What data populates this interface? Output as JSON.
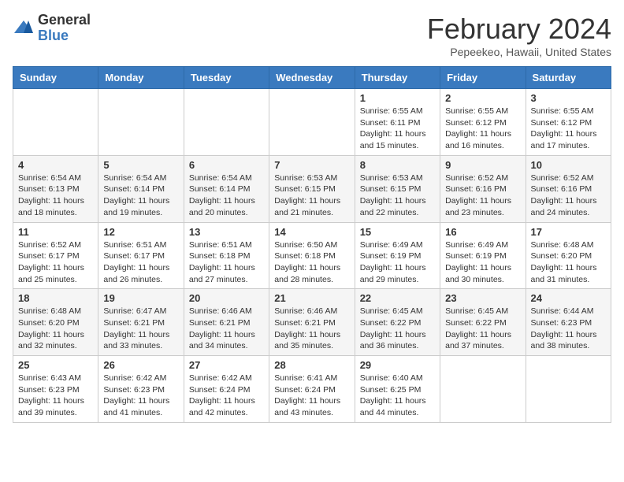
{
  "header": {
    "logo_general": "General",
    "logo_blue": "Blue",
    "month_title": "February 2024",
    "location": "Pepeekeo, Hawaii, United States"
  },
  "days_of_week": [
    "Sunday",
    "Monday",
    "Tuesday",
    "Wednesday",
    "Thursday",
    "Friday",
    "Saturday"
  ],
  "weeks": [
    [
      {
        "day": "",
        "info": ""
      },
      {
        "day": "",
        "info": ""
      },
      {
        "day": "",
        "info": ""
      },
      {
        "day": "",
        "info": ""
      },
      {
        "day": "1",
        "info": "Sunrise: 6:55 AM\nSunset: 6:11 PM\nDaylight: 11 hours and 15 minutes."
      },
      {
        "day": "2",
        "info": "Sunrise: 6:55 AM\nSunset: 6:12 PM\nDaylight: 11 hours and 16 minutes."
      },
      {
        "day": "3",
        "info": "Sunrise: 6:55 AM\nSunset: 6:12 PM\nDaylight: 11 hours and 17 minutes."
      }
    ],
    [
      {
        "day": "4",
        "info": "Sunrise: 6:54 AM\nSunset: 6:13 PM\nDaylight: 11 hours and 18 minutes."
      },
      {
        "day": "5",
        "info": "Sunrise: 6:54 AM\nSunset: 6:14 PM\nDaylight: 11 hours and 19 minutes."
      },
      {
        "day": "6",
        "info": "Sunrise: 6:54 AM\nSunset: 6:14 PM\nDaylight: 11 hours and 20 minutes."
      },
      {
        "day": "7",
        "info": "Sunrise: 6:53 AM\nSunset: 6:15 PM\nDaylight: 11 hours and 21 minutes."
      },
      {
        "day": "8",
        "info": "Sunrise: 6:53 AM\nSunset: 6:15 PM\nDaylight: 11 hours and 22 minutes."
      },
      {
        "day": "9",
        "info": "Sunrise: 6:52 AM\nSunset: 6:16 PM\nDaylight: 11 hours and 23 minutes."
      },
      {
        "day": "10",
        "info": "Sunrise: 6:52 AM\nSunset: 6:16 PM\nDaylight: 11 hours and 24 minutes."
      }
    ],
    [
      {
        "day": "11",
        "info": "Sunrise: 6:52 AM\nSunset: 6:17 PM\nDaylight: 11 hours and 25 minutes."
      },
      {
        "day": "12",
        "info": "Sunrise: 6:51 AM\nSunset: 6:17 PM\nDaylight: 11 hours and 26 minutes."
      },
      {
        "day": "13",
        "info": "Sunrise: 6:51 AM\nSunset: 6:18 PM\nDaylight: 11 hours and 27 minutes."
      },
      {
        "day": "14",
        "info": "Sunrise: 6:50 AM\nSunset: 6:18 PM\nDaylight: 11 hours and 28 minutes."
      },
      {
        "day": "15",
        "info": "Sunrise: 6:49 AM\nSunset: 6:19 PM\nDaylight: 11 hours and 29 minutes."
      },
      {
        "day": "16",
        "info": "Sunrise: 6:49 AM\nSunset: 6:19 PM\nDaylight: 11 hours and 30 minutes."
      },
      {
        "day": "17",
        "info": "Sunrise: 6:48 AM\nSunset: 6:20 PM\nDaylight: 11 hours and 31 minutes."
      }
    ],
    [
      {
        "day": "18",
        "info": "Sunrise: 6:48 AM\nSunset: 6:20 PM\nDaylight: 11 hours and 32 minutes."
      },
      {
        "day": "19",
        "info": "Sunrise: 6:47 AM\nSunset: 6:21 PM\nDaylight: 11 hours and 33 minutes."
      },
      {
        "day": "20",
        "info": "Sunrise: 6:46 AM\nSunset: 6:21 PM\nDaylight: 11 hours and 34 minutes."
      },
      {
        "day": "21",
        "info": "Sunrise: 6:46 AM\nSunset: 6:21 PM\nDaylight: 11 hours and 35 minutes."
      },
      {
        "day": "22",
        "info": "Sunrise: 6:45 AM\nSunset: 6:22 PM\nDaylight: 11 hours and 36 minutes."
      },
      {
        "day": "23",
        "info": "Sunrise: 6:45 AM\nSunset: 6:22 PM\nDaylight: 11 hours and 37 minutes."
      },
      {
        "day": "24",
        "info": "Sunrise: 6:44 AM\nSunset: 6:23 PM\nDaylight: 11 hours and 38 minutes."
      }
    ],
    [
      {
        "day": "25",
        "info": "Sunrise: 6:43 AM\nSunset: 6:23 PM\nDaylight: 11 hours and 39 minutes."
      },
      {
        "day": "26",
        "info": "Sunrise: 6:42 AM\nSunset: 6:23 PM\nDaylight: 11 hours and 41 minutes."
      },
      {
        "day": "27",
        "info": "Sunrise: 6:42 AM\nSunset: 6:24 PM\nDaylight: 11 hours and 42 minutes."
      },
      {
        "day": "28",
        "info": "Sunrise: 6:41 AM\nSunset: 6:24 PM\nDaylight: 11 hours and 43 minutes."
      },
      {
        "day": "29",
        "info": "Sunrise: 6:40 AM\nSunset: 6:25 PM\nDaylight: 11 hours and 44 minutes."
      },
      {
        "day": "",
        "info": ""
      },
      {
        "day": "",
        "info": ""
      }
    ]
  ]
}
